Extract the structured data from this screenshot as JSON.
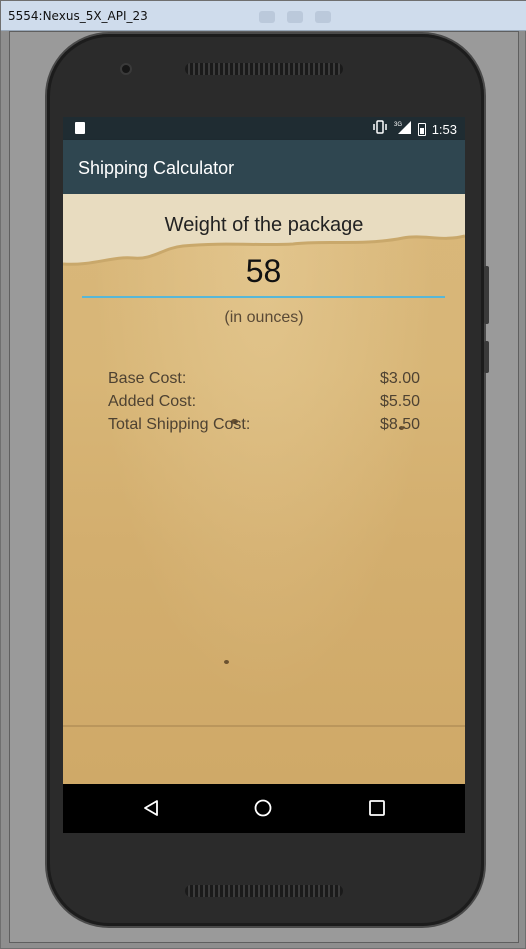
{
  "window": {
    "title": "5554:Nexus_5X_API_23"
  },
  "statusbar": {
    "time": "1:53",
    "network": "3G"
  },
  "app": {
    "title": "Shipping Calculator"
  },
  "form": {
    "weight_label": "Weight of the package",
    "weight_value": "58",
    "units_label": "(in ounces)"
  },
  "costs": [
    {
      "label": "Base Cost:",
      "value": "$3.00"
    },
    {
      "label": "Added Cost:",
      "value": "$5.50"
    },
    {
      "label": "Total Shipping Cost:",
      "value": "$8.50"
    }
  ],
  "colors": {
    "appbar": "#2f4650",
    "statusbar": "#1f2c32",
    "input_underline": "#58b7d7",
    "background": "#d8b677"
  },
  "icons": [
    "sd-card-icon",
    "vibrate-icon",
    "signal-icon",
    "battery-icon",
    "back-icon",
    "home-icon",
    "recents-icon"
  ]
}
